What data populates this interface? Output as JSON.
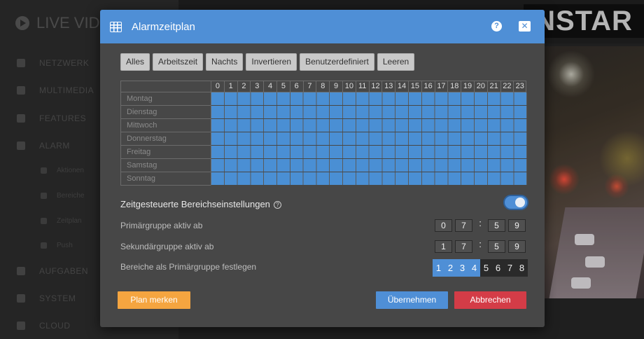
{
  "background": {
    "brand": "LIVE VID",
    "logo_text": "INSTAR",
    "nav": [
      {
        "label": "NETZWERK"
      },
      {
        "label": "MULTIMEDIA"
      },
      {
        "label": "FEATURES"
      },
      {
        "label": "ALARM"
      }
    ],
    "alarm_sub": [
      {
        "label": "Aktionen"
      },
      {
        "label": "Bereiche"
      },
      {
        "label": "Zeitplan"
      },
      {
        "label": "Push"
      }
    ],
    "nav_bottom": [
      {
        "label": "AUFGABEN"
      },
      {
        "label": "SYSTEM"
      },
      {
        "label": "CLOUD"
      }
    ]
  },
  "modal": {
    "title": "Alarmzeitplan",
    "help_label": "?",
    "close_label": "✕",
    "presets": [
      "Alles",
      "Arbeitszeit",
      "Nachts",
      "Invertieren",
      "Benutzerdefiniert",
      "Leeren"
    ],
    "hours": [
      "0",
      "1",
      "2",
      "3",
      "4",
      "5",
      "6",
      "7",
      "8",
      "9",
      "10",
      "11",
      "12",
      "13",
      "14",
      "15",
      "16",
      "17",
      "18",
      "19",
      "20",
      "21",
      "22",
      "23"
    ],
    "days": [
      "Montag",
      "Dienstag",
      "Mittwoch",
      "Donnerstag",
      "Freitag",
      "Samstag",
      "Sonntag"
    ],
    "schedule_all_active": true,
    "zone_settings_label": "Zeitgesteuerte Bereichseinstellungen",
    "zone_settings_help": "?",
    "zone_settings_enabled": true,
    "primary_label": "Primärgruppe aktiv ab",
    "primary_time": [
      "0",
      "7",
      ":",
      "5",
      "9"
    ],
    "secondary_label": "Sekundärgruppe aktiv ab",
    "secondary_time": [
      "1",
      "7",
      ":",
      "5",
      "9"
    ],
    "primary_areas_label": "Bereiche als Primärgruppe festlegen",
    "areas": [
      {
        "label": "1",
        "selected": true
      },
      {
        "label": "2",
        "selected": true
      },
      {
        "label": "3",
        "selected": true
      },
      {
        "label": "4",
        "selected": true
      },
      {
        "label": "5",
        "selected": false
      },
      {
        "label": "6",
        "selected": false
      },
      {
        "label": "7",
        "selected": false
      },
      {
        "label": "8",
        "selected": false
      }
    ],
    "save_plan_label": "Plan merken",
    "apply_label": "Übernehmen",
    "cancel_label": "Abbrechen",
    "colors": {
      "header": "#4f8fd6",
      "active_cell": "#4a8fd4",
      "save_plan": "#f5a540",
      "apply": "#4f8fd6",
      "cancel": "#d43c47"
    }
  }
}
